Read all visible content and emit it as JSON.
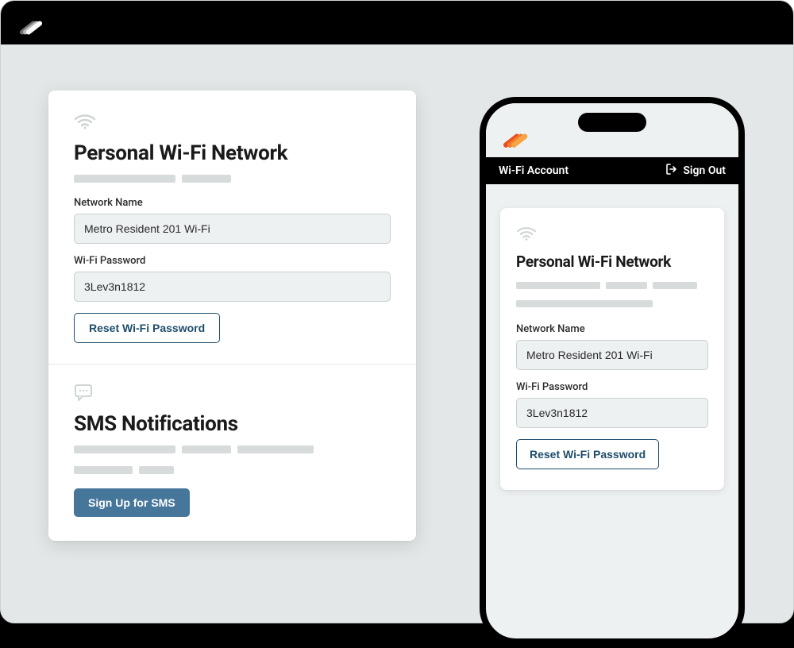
{
  "desktop": {
    "wifi_section": {
      "title": "Personal Wi-Fi Network",
      "network_name_label": "Network Name",
      "network_name_value": "Metro Resident 201 Wi-Fi",
      "password_label": "Wi-Fi Password",
      "password_value": "3Lev3n1812",
      "reset_button": "Reset Wi-Fi Password"
    },
    "sms_section": {
      "title": "SMS Notifications",
      "signup_button": "Sign Up for SMS"
    }
  },
  "mobile": {
    "navbar": {
      "title": "Wi-Fi Account",
      "signout": "Sign Out"
    },
    "wifi_section": {
      "title": "Personal Wi-Fi Network",
      "network_name_label": "Network Name",
      "network_name_value": "Metro Resident 201 Wi-Fi",
      "password_label": "Wi-Fi Password",
      "password_value": "3Lev3n1812",
      "reset_button": "Reset Wi-Fi Password"
    }
  }
}
